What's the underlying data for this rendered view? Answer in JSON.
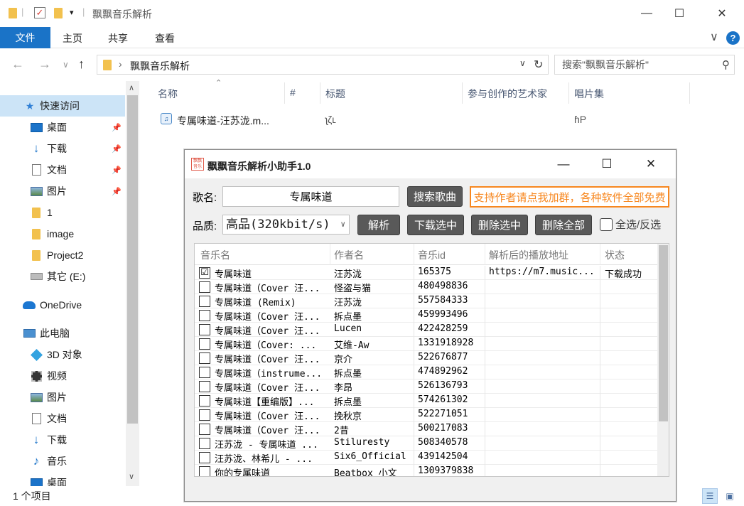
{
  "window": {
    "title": "飘飘音乐解析",
    "minimize": "—",
    "maximize": "☐",
    "close": "✕"
  },
  "ribbon": {
    "file": "文件",
    "tabs": [
      "主页",
      "共享",
      "查看"
    ],
    "collapse": "∨",
    "help": "?"
  },
  "address": {
    "path": "飘飘音乐解析",
    "back": "←",
    "forward": "→",
    "recent": "∨",
    "up": "↑",
    "dropdown": "∨",
    "refresh": "↻",
    "search_placeholder": "搜索\"飘飘音乐解析\""
  },
  "nav": {
    "items": [
      {
        "label": "快速访问",
        "icon": "star-icon"
      },
      {
        "label": "桌面",
        "icon": "desktop-icon",
        "pinned": true
      },
      {
        "label": "下载",
        "icon": "download-icon",
        "pinned": true
      },
      {
        "label": "文档",
        "icon": "document-icon",
        "pinned": true
      },
      {
        "label": "图片",
        "icon": "picture-icon",
        "pinned": true
      },
      {
        "label": "1",
        "icon": "folder-icon"
      },
      {
        "label": "image",
        "icon": "folder-icon"
      },
      {
        "label": "Project2",
        "icon": "folder-icon"
      },
      {
        "label": "其它 (E:)",
        "icon": "drive-icon"
      },
      {
        "label": "OneDrive",
        "icon": "onedrive-icon"
      },
      {
        "label": "此电脑",
        "icon": "this-pc-icon"
      },
      {
        "label": "3D 对象",
        "icon": "3d-objects-icon"
      },
      {
        "label": "视频",
        "icon": "video-icon"
      },
      {
        "label": "图片",
        "icon": "picture-icon"
      },
      {
        "label": "文档",
        "icon": "document-icon"
      },
      {
        "label": "下载",
        "icon": "download-icon"
      },
      {
        "label": "音乐",
        "icon": "music-icon"
      },
      {
        "label": "桌面",
        "icon": "desktop-icon"
      }
    ]
  },
  "files": {
    "columns": [
      "名称",
      "#",
      "标题",
      "参与创作的艺术家",
      "唱片集"
    ],
    "rows": [
      {
        "name": "专属味道-汪苏泷.m...",
        "title": "ʅζʟ",
        "album": "ɦP"
      }
    ]
  },
  "status": {
    "count": "1 个项目"
  },
  "app": {
    "title": "飘飘音乐解析小助手1.0",
    "logo_text": "飘飘音乐",
    "song_label": "歌名:",
    "song_value": "专属味道",
    "search_button": "搜索歌曲",
    "promo_button": "支持作者请点我加群，各种软件全部免费",
    "quality_label": "品质:",
    "quality_value": "高品(320kbit/s)",
    "parse_button": "解析",
    "download_button": "下载选中",
    "delete_button": "删除选中",
    "delete_all_button": "删除全部",
    "select_all_label": "全选/反选",
    "columns": [
      "音乐名",
      "作者名",
      "音乐id",
      "解析后的播放地址",
      "状态"
    ],
    "rows": [
      {
        "checked": "☑",
        "name": "专属味道",
        "artist": "汪苏泷",
        "id": "165375",
        "url": "https://m7.music...",
        "status": "下载成功"
      },
      {
        "checked": "",
        "name": "专属味道（Cover 汪...",
        "artist": "怪盗与猫",
        "id": "480498836",
        "url": "",
        "status": ""
      },
      {
        "checked": "",
        "name": "专属味道 (Remix)",
        "artist": "汪苏泷",
        "id": "557584333",
        "url": "",
        "status": ""
      },
      {
        "checked": "",
        "name": "专属味道（Cover 汪...",
        "artist": "拆点墨",
        "id": "459993496",
        "url": "",
        "status": ""
      },
      {
        "checked": "",
        "name": "专属味道（Cover 汪...",
        "artist": "Lucen",
        "id": "422428259",
        "url": "",
        "status": ""
      },
      {
        "checked": "",
        "name": "专属味道（Cover: ...",
        "artist": "艾维-Aw",
        "id": "1331918928",
        "url": "",
        "status": ""
      },
      {
        "checked": "",
        "name": "专属味道（Cover 汪...",
        "artist": "京介",
        "id": "522676877",
        "url": "",
        "status": ""
      },
      {
        "checked": "",
        "name": "专属味道（instrume...",
        "artist": "拆点墨",
        "id": "474892962",
        "url": "",
        "status": ""
      },
      {
        "checked": "",
        "name": "专属味道（Cover 汪...",
        "artist": "李昂",
        "id": "526136793",
        "url": "",
        "status": ""
      },
      {
        "checked": "",
        "name": "专属味道【重编版】...",
        "artist": "拆点墨",
        "id": "574261302",
        "url": "",
        "status": ""
      },
      {
        "checked": "",
        "name": "专属味道（Cover 汪...",
        "artist": "挽秋京",
        "id": "522271051",
        "url": "",
        "status": ""
      },
      {
        "checked": "",
        "name": "专属味道（Cover 汪...",
        "artist": "2昔",
        "id": "500217083",
        "url": "",
        "status": ""
      },
      {
        "checked": "",
        "name": "汪苏泷 - 专属味道 ...",
        "artist": "Stiluresty",
        "id": "508340578",
        "url": "",
        "status": ""
      },
      {
        "checked": "",
        "name": "汪苏泷、林希儿 - ...",
        "artist": "Six6_Official",
        "id": "439142504",
        "url": "",
        "status": ""
      },
      {
        "checked": "",
        "name": "你的专属味道",
        "artist": "Beatbox 小文",
        "id": "1309379838",
        "url": "",
        "status": ""
      }
    ]
  }
}
